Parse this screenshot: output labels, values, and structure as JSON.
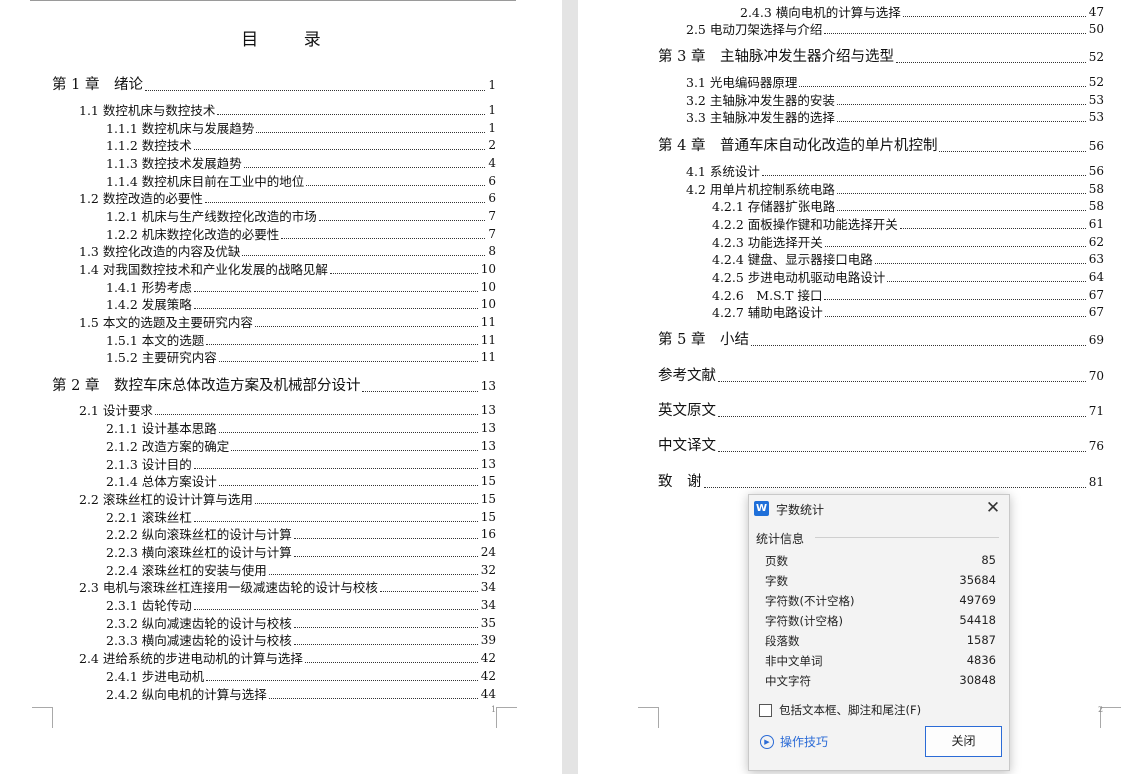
{
  "page1": {
    "title": "目 录",
    "page_number": "1",
    "entries": [
      {
        "t": "第 1 章　绪论",
        "p": "1"
      },
      {
        "t": "1.1 数控机床与数控技术",
        "p": "1"
      },
      {
        "t": "1.1.1 数控机床与发展趋势",
        "p": "1"
      },
      {
        "t": "1.1.2 数控技术",
        "p": "2"
      },
      {
        "t": "1.1.3 数控技术发展趋势",
        "p": "4"
      },
      {
        "t": "1.1.4 数控机床目前在工业中的地位",
        "p": "6"
      },
      {
        "t": "1.2 数控改造的必要性",
        "p": "6"
      },
      {
        "t": "1.2.1 机床与生产线数控化改造的市场",
        "p": "7"
      },
      {
        "t": "1.2.2 机床数控化改造的必要性",
        "p": "7"
      },
      {
        "t": "1.3 数控化改造的内容及优缺",
        "p": "8"
      },
      {
        "t": "1.4 对我国数控技术和产业化发展的战略见解",
        "p": "10"
      },
      {
        "t": "1.4.1 形势考虑",
        "p": "10"
      },
      {
        "t": "1.4.2 发展策略",
        "p": "10"
      },
      {
        "t": "1.5 本文的选题及主要研究内容",
        "p": "11"
      },
      {
        "t": "1.5.1 本文的选题",
        "p": "11"
      },
      {
        "t": "1.5.2 主要研究内容",
        "p": "11"
      },
      {
        "t": "第 2 章　数控车床总体改造方案及机械部分设计",
        "p": "13"
      },
      {
        "t": "2.1 设计要求",
        "p": "13"
      },
      {
        "t": "2.1.1 设计基本思路",
        "p": "13"
      },
      {
        "t": "2.1.2 改造方案的确定",
        "p": "13"
      },
      {
        "t": "2.1.3 设计目的",
        "p": "13"
      },
      {
        "t": "2.1.4 总体方案设计",
        "p": "15"
      },
      {
        "t": "2.2 滚珠丝杠的设计计算与选用",
        "p": "15"
      },
      {
        "t": "2.2.1 滚珠丝杠",
        "p": "15"
      },
      {
        "t": "2.2.2 纵向滚珠丝杠的设计与计算",
        "p": "16"
      },
      {
        "t": "2.2.3 横向滚珠丝杠的设计与计算",
        "p": "24"
      },
      {
        "t": "2.2.4 滚珠丝杠的安装与使用",
        "p": "32"
      },
      {
        "t": "2.3 电机与滚珠丝杠连接用一级减速齿轮的设计与校核",
        "p": "34"
      },
      {
        "t": "2.3.1 齿轮传动",
        "p": "34"
      },
      {
        "t": "2.3.2 纵向减速齿轮的设计与校核",
        "p": "35"
      },
      {
        "t": "2.3.3 横向减速齿轮的设计与校核",
        "p": "39"
      },
      {
        "t": "2.4 进给系统的步进电动机的计算与选择",
        "p": "42"
      },
      {
        "t": "2.4.1 步进电动机",
        "p": "42"
      },
      {
        "t": "2.4.2 纵向电机的计算与选择",
        "p": "44"
      }
    ]
  },
  "page2": {
    "page_number": "2",
    "entries": [
      {
        "t": "2.4.3 横向电机的计算与选择",
        "p": "47"
      },
      {
        "t": "2.5 电动刀架选择与介绍",
        "p": "50"
      },
      {
        "t": "第 3 章　主轴脉冲发生器介绍与选型",
        "p": "52"
      },
      {
        "t": "3.1 光电编码器原理",
        "p": "52"
      },
      {
        "t": "3.2 主轴脉冲发生器的安装",
        "p": "53"
      },
      {
        "t": "3.3 主轴脉冲发生器的选择",
        "p": "53"
      },
      {
        "t": "第 4 章　普通车床自动化改造的单片机控制",
        "p": "56"
      },
      {
        "t": "4.1 系统设计",
        "p": "56"
      },
      {
        "t": "4.2 用单片机控制系统电路",
        "p": "58"
      },
      {
        "t": "4.2.1 存储器扩张电路",
        "p": "58"
      },
      {
        "t": "4.2.2 面板操作键和功能选择开关",
        "p": "61"
      },
      {
        "t": "4.2.3 功能选择开关",
        "p": "62"
      },
      {
        "t": "4.2.4 键盘、显示器接口电路",
        "p": "63"
      },
      {
        "t": "4.2.5 步进电动机驱动电路设计",
        "p": "64"
      },
      {
        "t": "4.2.6　M.S.T 接口",
        "p": "67"
      },
      {
        "t": "4.2.7 辅助电路设计",
        "p": "67"
      },
      {
        "t": "第 5 章　小结",
        "p": "69"
      },
      {
        "t": "参考文献",
        "p": "70"
      },
      {
        "t": "英文原文",
        "p": "71"
      },
      {
        "t": "中文译文",
        "p": "76"
      },
      {
        "t": "致　谢",
        "p": "81"
      }
    ]
  },
  "dialog": {
    "title": "字数统计",
    "app_icon_letter": "W",
    "close_glyph": "✕",
    "section": "统计信息",
    "stats": [
      {
        "label": "页数",
        "value": "85"
      },
      {
        "label": "字数",
        "value": "35684"
      },
      {
        "label": "字符数(不计空格)",
        "value": "49769"
      },
      {
        "label": "字符数(计空格)",
        "value": "54418"
      },
      {
        "label": "段落数",
        "value": "1587"
      },
      {
        "label": "非中文单词",
        "value": "4836"
      },
      {
        "label": "中文字符",
        "value": "30848"
      }
    ],
    "checkbox_label": "包括文本框、脚注和尾注(F)",
    "checkbox_checked": false,
    "tips_label": "操作技巧",
    "close_button": "关闭",
    "accent_color": "#2b6bd6"
  }
}
